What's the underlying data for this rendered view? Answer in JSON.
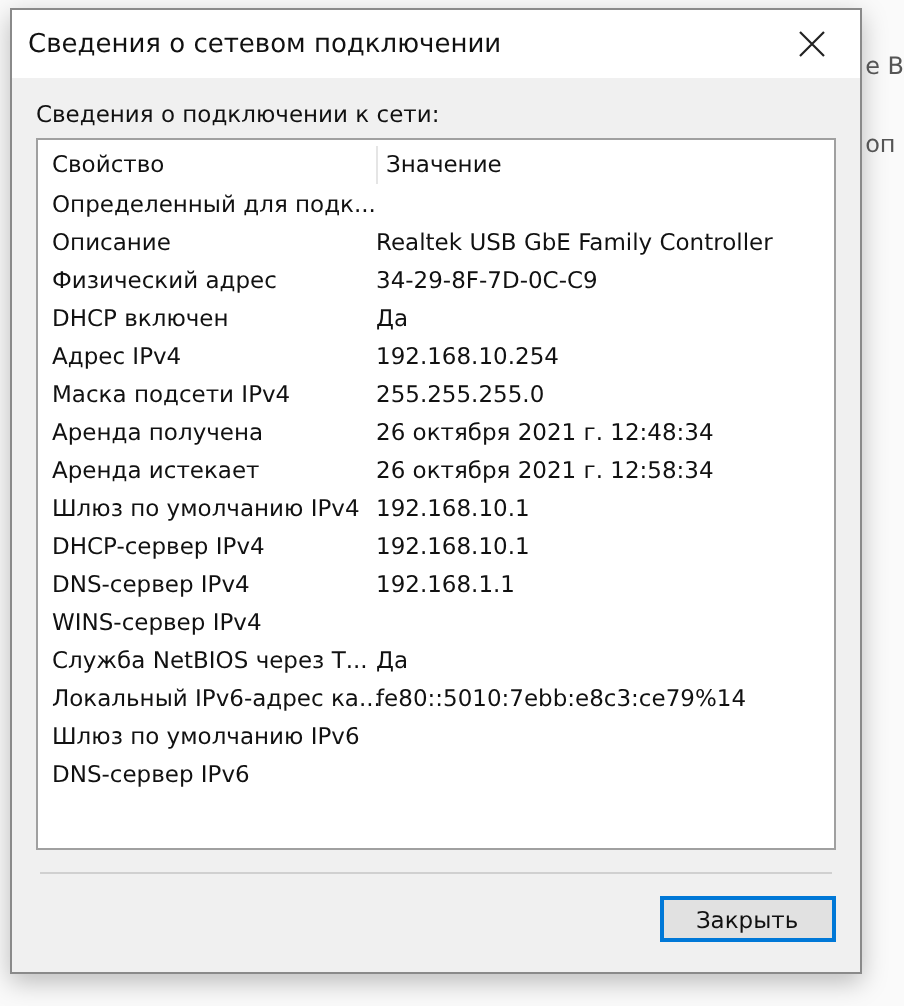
{
  "window": {
    "title": "Сведения о сетевом подключении"
  },
  "group_label": "Сведения о подключении к сети:",
  "table": {
    "columns": [
      "Свойство",
      "Значение"
    ],
    "rows": [
      {
        "property": "Определенный для подк...",
        "value": ""
      },
      {
        "property": "Описание",
        "value": "Realtek USB GbE Family Controller"
      },
      {
        "property": "Физический адрес",
        "value": "34-29-8F-7D-0C-C9"
      },
      {
        "property": "DHCP включен",
        "value": "Да"
      },
      {
        "property": "Адрес IPv4",
        "value": "192.168.10.254"
      },
      {
        "property": "Маска подсети IPv4",
        "value": "255.255.255.0"
      },
      {
        "property": "Аренда получена",
        "value": "26 октября 2021 г. 12:48:34"
      },
      {
        "property": "Аренда истекает",
        "value": "26 октября 2021 г. 12:58:34"
      },
      {
        "property": "Шлюз по умолчанию IPv4",
        "value": "192.168.10.1"
      },
      {
        "property": "DHCP-сервер IPv4",
        "value": "192.168.10.1"
      },
      {
        "property": "DNS-сервер IPv4",
        "value": "192.168.1.1"
      },
      {
        "property": "WINS-сервер IPv4",
        "value": ""
      },
      {
        "property": "Служба NetBIOS через Т...",
        "value": "Да"
      },
      {
        "property": "Локальный IPv6-адрес ка...",
        "value": "fe80::5010:7ebb:e8c3:ce79%14"
      },
      {
        "property": "Шлюз по умолчанию IPv6",
        "value": ""
      },
      {
        "property": "DNS-сервер IPv6",
        "value": ""
      }
    ]
  },
  "buttons": [
    {
      "label": "Закрыть",
      "focused": true
    }
  ],
  "background_window": {
    "texts": [
      "е В",
      "оп"
    ]
  }
}
